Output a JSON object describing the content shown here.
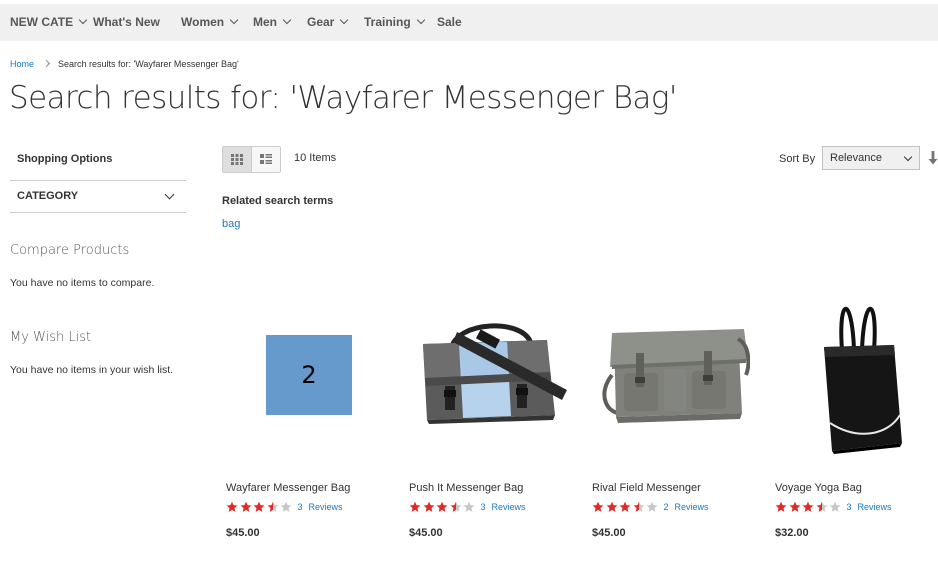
{
  "nav": {
    "items": [
      {
        "label": "NEW CATE",
        "dropdown": true
      },
      {
        "label": "What's New",
        "dropdown": false
      },
      {
        "label": "Women",
        "dropdown": true
      },
      {
        "label": "Men",
        "dropdown": true
      },
      {
        "label": "Gear",
        "dropdown": true
      },
      {
        "label": "Training",
        "dropdown": true
      },
      {
        "label": "Sale",
        "dropdown": false
      }
    ]
  },
  "breadcrumb": {
    "home": "Home",
    "current": "Search results for: 'Wayfarer Messenger Bag'"
  },
  "page_title": "Search results for: 'Wayfarer Messenger Bag'",
  "sidebar": {
    "shopping_options": "Shopping Options",
    "filter_label": "CATEGORY",
    "compare_title": "Compare Products",
    "compare_text": "You have no items to compare.",
    "wishlist_title": "My Wish List",
    "wishlist_text": "You have no items in your wish list."
  },
  "toolbar": {
    "count": "10 Items",
    "sort_label": "Sort By",
    "sort_value": "Relevance"
  },
  "related": {
    "title": "Related search terms",
    "term": "bag"
  },
  "products": [
    {
      "name": "Wayfarer Messenger Bag",
      "rating": 3.5,
      "review_count": "3",
      "review_label": "Reviews",
      "price": "$45.00",
      "image": "placeholder",
      "placeholder_text": "2"
    },
    {
      "name": "Push It Messenger Bag",
      "rating": 3.5,
      "review_count": "3",
      "review_label": "Reviews",
      "price": "$45.00",
      "image": "messenger-bag-blue"
    },
    {
      "name": "Rival Field Messenger",
      "rating": 3.5,
      "review_count": "2",
      "review_label": "Reviews",
      "price": "$45.00",
      "image": "messenger-bag-grey"
    },
    {
      "name": "Voyage Yoga Bag",
      "rating": 3.5,
      "review_count": "3",
      "review_label": "Reviews",
      "price": "$32.00",
      "image": "tote-bag-black"
    }
  ],
  "colors": {
    "link": "#1979c3",
    "star_filled": "#e02b27",
    "star_empty": "#c7c7c7",
    "nav_bg": "#f0f0f0",
    "placeholder": "#6699cc"
  }
}
